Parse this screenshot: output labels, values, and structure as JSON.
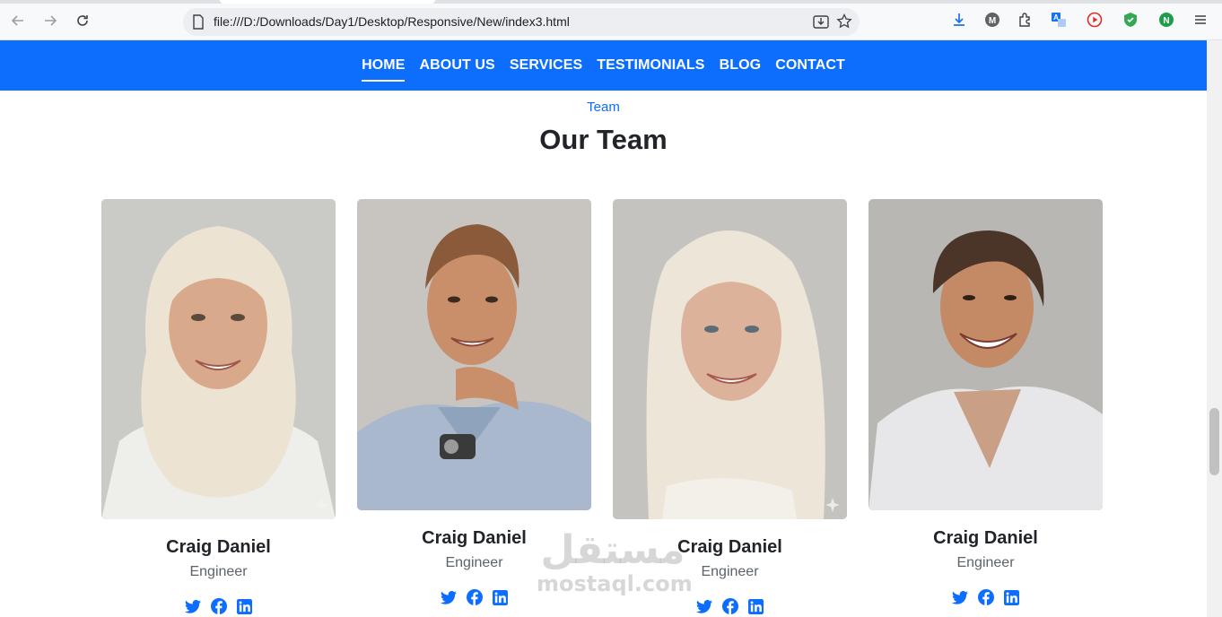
{
  "browser": {
    "url": "file:///D:/Downloads/Day1/Desktop/Responsive/New/index3.html"
  },
  "nav": {
    "items": [
      {
        "label": "HOME",
        "active": true
      },
      {
        "label": "ABOUT US",
        "active": false
      },
      {
        "label": "SERVICES",
        "active": false
      },
      {
        "label": "TESTIMONIALS",
        "active": false
      },
      {
        "label": "BLOG",
        "active": false
      },
      {
        "label": "CONTACT",
        "active": false
      }
    ],
    "accent_color": "#0d6efd"
  },
  "section": {
    "subtitle": "Team",
    "title": "Our Team"
  },
  "team": [
    {
      "name": "Craig Daniel",
      "role": "Engineer",
      "photo": "woman-hijab-portrait"
    },
    {
      "name": "Craig Daniel",
      "role": "Engineer",
      "photo": "man-smiling-portrait"
    },
    {
      "name": "Craig Daniel",
      "role": "Engineer",
      "photo": "woman-hijab-portrait"
    },
    {
      "name": "Craig Daniel",
      "role": "Engineer",
      "photo": "man-laughing-portrait"
    }
  ],
  "social_icons": [
    "twitter-icon",
    "facebook-icon",
    "linkedin-icon"
  ],
  "watermark": {
    "arabic": "مستقل",
    "latin": "mostaql.com"
  }
}
